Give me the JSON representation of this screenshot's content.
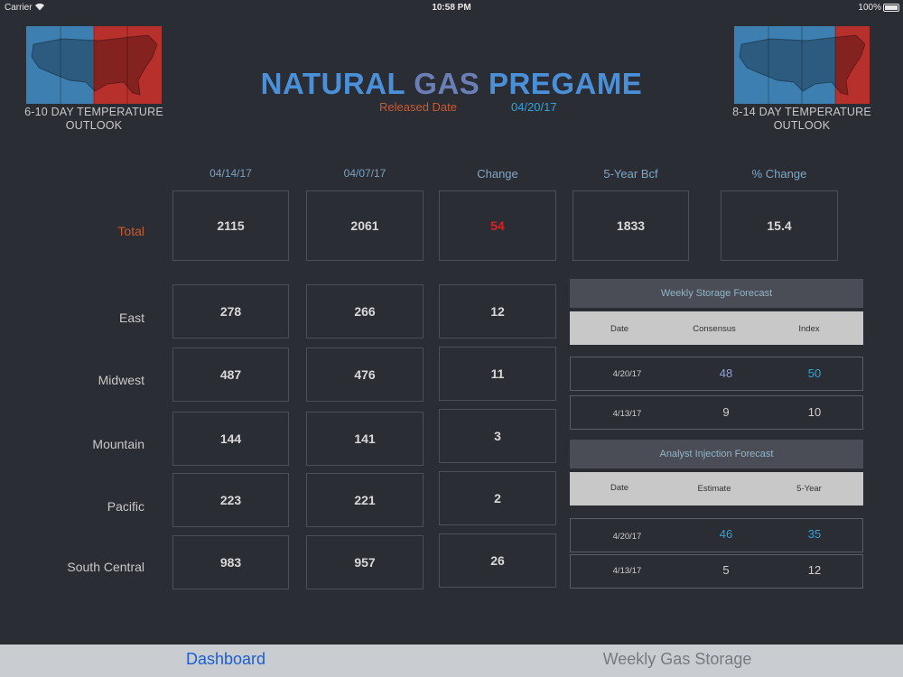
{
  "status_bar": {
    "carrier": "Carrier",
    "wifi_icon": "wifi-icon",
    "time": "10:58 PM",
    "battery_percent": "100%",
    "battery_level": 1.0
  },
  "header": {
    "title_part1": "NATURAL",
    "title_part2": "GAS",
    "title_part3": "PREGAME",
    "released_label": "Released Date",
    "released_date": "04/20/17",
    "left_map_caption_line1": "6-10 DAY TEMPERATURE",
    "left_map_caption_line2": "OUTLOOK",
    "right_map_caption_line1": "8-14  DAY TEMPERATURE",
    "right_map_caption_line2": "OUTLOOK"
  },
  "columns": {
    "current_date": "04/14/17",
    "previous_date": "04/07/17",
    "change": "Change",
    "five_year": "5-Year Bcf",
    "pct_change": "% Change"
  },
  "total": {
    "label": "Total",
    "current": "2115",
    "previous": "2061",
    "change": "54",
    "five_year": "1833",
    "pct_change": "15.4"
  },
  "regions": [
    {
      "label": "East",
      "current": "278",
      "previous": "266",
      "change": "12"
    },
    {
      "label": "Midwest",
      "current": "487",
      "previous": "476",
      "change": "11"
    },
    {
      "label": "Mountain",
      "current": "144",
      "previous": "141",
      "change": "3"
    },
    {
      "label": "Pacific",
      "current": "223",
      "previous": "221",
      "change": "2"
    },
    {
      "label": "South Central",
      "current": "983",
      "previous": "957",
      "change": "26"
    }
  ],
  "weekly_storage_forecast": {
    "title": "Weekly Storage Forecast",
    "headers": [
      "Date",
      "Consensus",
      "Index"
    ],
    "rows": [
      {
        "date": "4/20/17",
        "a": "48",
        "b": "50"
      },
      {
        "date": "4/13/17",
        "a": "9",
        "b": "10"
      }
    ]
  },
  "analyst_injection_forecast": {
    "title": "Analyst Injection Forecast",
    "headers": [
      "Date",
      "Estimate",
      "5-Year"
    ],
    "rows": [
      {
        "date": "4/20/17",
        "a": "46",
        "b": "35"
      },
      {
        "date": "4/13/17",
        "a": "5",
        "b": "12"
      }
    ]
  },
  "tabs": [
    {
      "label": "Dashboard",
      "active": true
    },
    {
      "label": "Weekly Gas Storage",
      "active": false
    }
  ],
  "colors": {
    "background": "#2b2d35",
    "accent_blue": "#4a90d9",
    "accent_orange": "#c85a32",
    "change_red": "#e02020",
    "map_blue": "#3d7fb0",
    "map_red": "#b8302c"
  }
}
